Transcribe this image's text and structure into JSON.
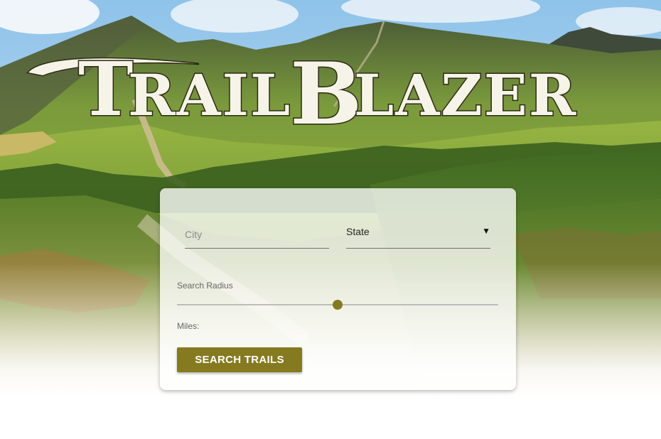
{
  "brand": {
    "name": "TrailBlazer",
    "colors": {
      "accent": "#857a1f",
      "logo_fill": "#f6f4e8",
      "logo_outline": "#2c2a12"
    }
  },
  "hero": {
    "image": "mountain-meadow-trail-photo"
  },
  "search": {
    "city_placeholder": "City",
    "city_value": "",
    "state_selected": "State",
    "state_arrow": "▼",
    "radius_label": "Search Radius",
    "radius_fraction": 0.5,
    "miles_label": "Miles:",
    "button_label": "SEARCH TRAILS"
  }
}
